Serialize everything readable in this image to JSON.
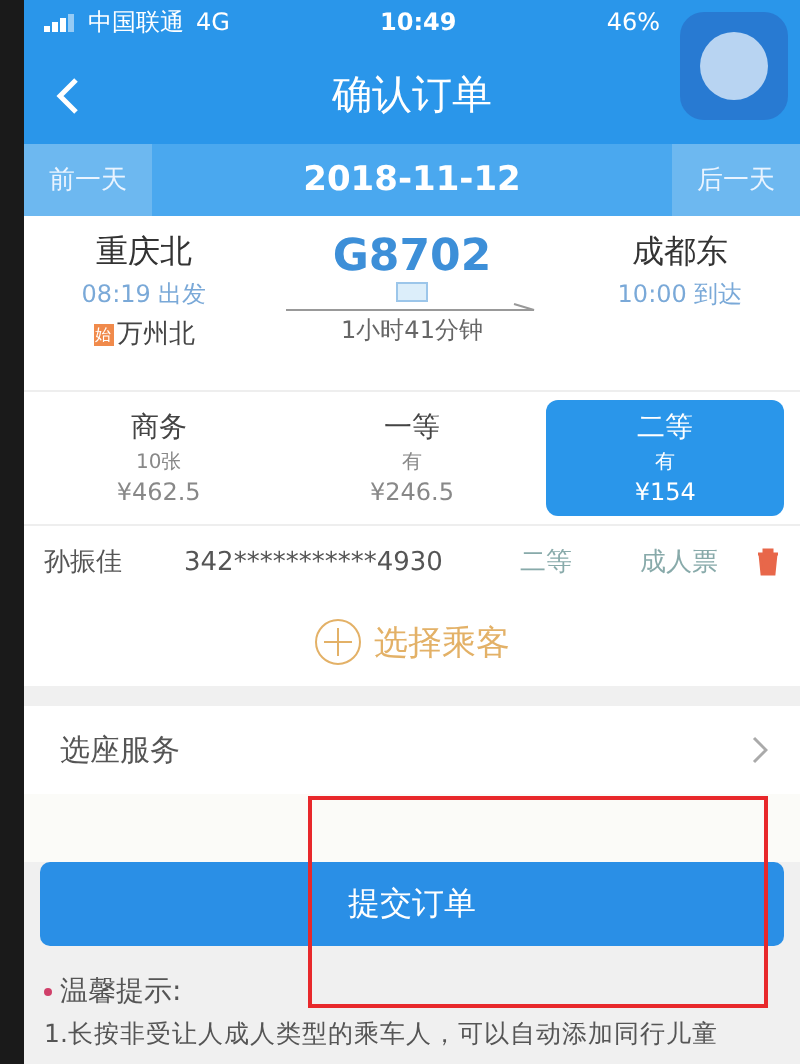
{
  "status_bar": {
    "carrier": "中国联通",
    "network": "4G",
    "time": "10:49",
    "battery": "46%"
  },
  "nav": {
    "title": "确认订单"
  },
  "date_bar": {
    "prev": "前一天",
    "date": "2018-11-12",
    "next": "后一天"
  },
  "train": {
    "from": "重庆北",
    "depart": "08:19 出发",
    "via_badge": "始",
    "via": "万州北",
    "number": "G8702",
    "duration": "1小时41分钟",
    "to": "成都东",
    "arrive": "10:00 到达"
  },
  "seats": [
    {
      "name": "商务",
      "availability": "10张",
      "price": "¥462.5",
      "selected": false
    },
    {
      "name": "一等",
      "availability": "有",
      "price": "¥246.5",
      "selected": false
    },
    {
      "name": "二等",
      "availability": "有",
      "price": "¥154",
      "selected": true
    }
  ],
  "passengers": [
    {
      "name": "孙振佳",
      "id": "342***********4930",
      "seat": "二等",
      "ticket": "成人票"
    }
  ],
  "add_passenger": "选择乘客",
  "seat_service": "选座服务",
  "submit": "提交订单",
  "tips": {
    "title": "温馨提示:",
    "lines": [
      "1.长按非受让人成人类型的乘车人，可以自动添加同行儿童"
    ]
  }
}
